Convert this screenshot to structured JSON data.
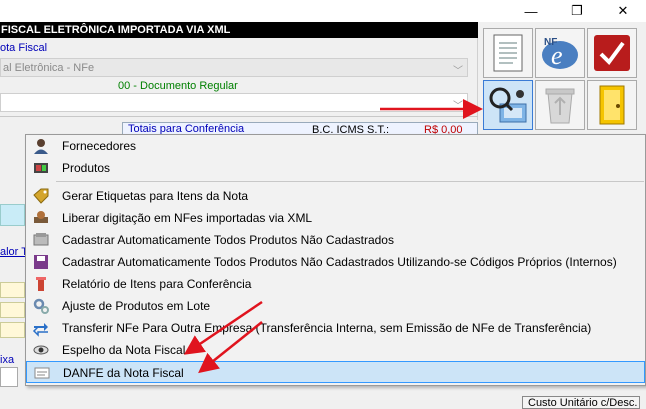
{
  "window": {
    "form_title": "FISCAL ELETRÔNICA IMPORTADA VIA XML",
    "minimize_glyph": "—",
    "restore_glyph": "❐",
    "close_glyph": "✕"
  },
  "form": {
    "tipo_label": "ota Fiscal",
    "modelo_value": "al Eletrônica - NFe",
    "situacao_text": "00 - Documento Regular",
    "totais_label": "Totais para Conferência",
    "bc_icms_label": "B.C. ICMS S.T.:",
    "bc_icms_value": "R$ 0,00",
    "valor_label": "alor To",
    "caixa_label": "ixa",
    "custo_label": "Custo Unitário c/Desc."
  },
  "toolbar": {
    "icons": [
      "document-icon",
      "nfe-logo-icon",
      "checkmark-icon",
      "magnifier-tools-icon",
      "recycle-bin-icon",
      "exit-door-icon"
    ]
  },
  "menu": {
    "items": [
      {
        "label": "Fornecedores",
        "icon": "suppliers-icon"
      },
      {
        "label": "Produtos",
        "icon": "products-icon"
      },
      {
        "label": "Gerar Etiquetas para Itens da Nota",
        "icon": "labels-icon"
      },
      {
        "label": "Liberar digitação em NFes importadas via XML",
        "icon": "release-icon"
      },
      {
        "label": "Cadastrar Automaticamente Todos Produtos Não Cadastrados",
        "icon": "auto-register-icon"
      },
      {
        "label": "Cadastrar Automaticamente Todos Produtos Não Cadastrados Utilizando-se Códigos Próprios (Internos)",
        "icon": "floppy-disk-icon"
      },
      {
        "label": "Relatório de Itens para Conferência",
        "icon": "report-icon"
      },
      {
        "label": "Ajuste de Produtos em Lote",
        "icon": "gears-icon"
      },
      {
        "label": "Transferir NFe Para Outra Empresa (Transferência Interna, sem Emissão de NFe de Transferência)",
        "icon": "transfer-icon"
      },
      {
        "label": "Espelho da Nota Fiscal",
        "icon": "eye-icon"
      },
      {
        "label": "DANFE da Nota Fiscal",
        "icon": "danfe-icon"
      }
    ]
  },
  "colors": {
    "arrow": "#e0141e",
    "highlight": "#cce4f7",
    "highlight_border": "#3399ff"
  }
}
